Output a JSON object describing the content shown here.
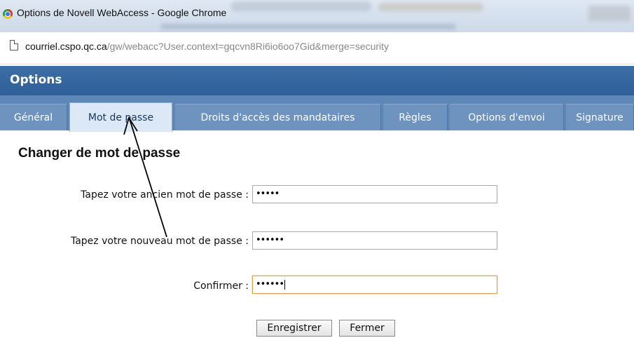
{
  "window": {
    "title": "Options de Novell WebAccess - Google Chrome",
    "icon": "chrome-icon"
  },
  "address_bar": {
    "url_host": "courriel.cspo.qc.ca",
    "url_path": "/gw/webacc?User.context=gqcvn8Ri6io6oo7Gid&merge=security"
  },
  "header": {
    "title": "Options"
  },
  "tabs": [
    {
      "label": "Général",
      "active": false
    },
    {
      "label": "Mot de passe",
      "active": true
    },
    {
      "label": "Droits d'accès des mandataires",
      "active": false
    },
    {
      "label": "Règles",
      "active": false
    },
    {
      "label": "Options d'envoi",
      "active": false
    },
    {
      "label": "Signature",
      "active": false
    }
  ],
  "form": {
    "title": "Changer de mot de passe",
    "old_password": {
      "label": "Tapez votre ancien mot de passe :",
      "value": "•••••"
    },
    "new_password": {
      "label": "Tapez votre nouveau mot de passe :",
      "value": "••••••"
    },
    "confirm_password": {
      "label": "Confirmer :",
      "value": "••••••"
    },
    "save_label": "Enregistrer",
    "close_label": "Fermer"
  },
  "annotation": {
    "type": "arrow",
    "color": "#000000",
    "points_to": "tab-mot-de-passe"
  },
  "colors": {
    "header_bg": "#3465a4",
    "tabs_bg": "#5f87b6",
    "active_tab_bg": "#dce8f6",
    "focus_border": "#d9a24a"
  }
}
